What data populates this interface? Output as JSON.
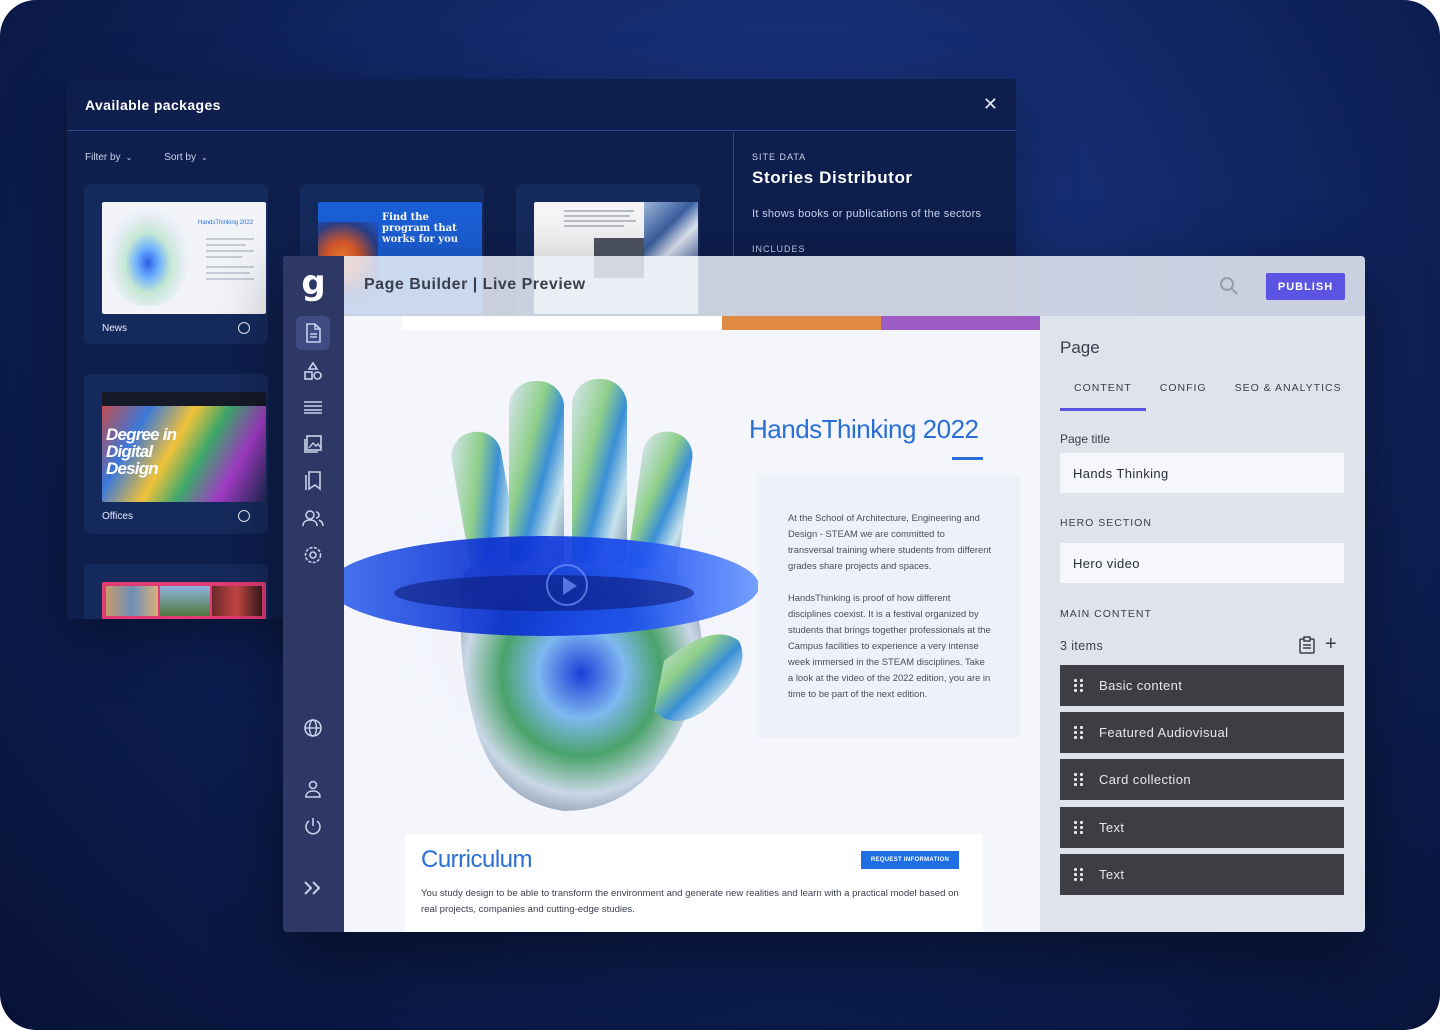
{
  "packages": {
    "title": "Available packages",
    "filter_label": "Filter by",
    "sort_label": "Sort by",
    "cards": [
      {
        "label": "News",
        "mini_title": "HandsThinking 2022"
      },
      {
        "label": "",
        "headline": "Find the program that works for you"
      },
      {
        "label": ""
      },
      {
        "label": "Offices",
        "headline": "Degree in Digital Design"
      },
      {
        "label": ""
      }
    ],
    "site_data": {
      "label": "SITE DATA",
      "title": "Stories Distributor",
      "description": "It shows books or publications of the sectors",
      "includes_label": "INCLUDES"
    }
  },
  "builder": {
    "logo": "g",
    "title": "Page Builder | Live Preview",
    "publish_label": "PUBLISH",
    "nav_icons": [
      "document-icon",
      "shapes-icon",
      "menu-lines-icon",
      "image-icon",
      "bookmark-icon",
      "users-icon",
      "settings-icon",
      "globe-icon",
      "user-icon",
      "power-icon",
      "expand-icon"
    ],
    "preview": {
      "hero_title": "HandsThinking 2022",
      "hero_paragraphs": [
        "At the School of Architecture, Engineering and Design - STEAM we are committed to transversal training where students from different grades share projects and spaces.",
        "HandsThinking is proof of how different disciplines coexist. It is a festival organized by students that brings together professionals at the Campus facilities to experience a very intense week immersed in the STEAM disciplines. Take a look at the video of the 2022 edition, you are in time to be part of the next edition."
      ],
      "curriculum_title": "Curriculum",
      "curriculum_button": "REQUEST INFORMATION",
      "curriculum_text": "You study design to be able to transform the environment and generate new realities and learn with a practical model based on real projects, companies and cutting-edge studies."
    },
    "panel": {
      "title": "Page",
      "tabs": [
        "CONTENT",
        "CONFIG",
        "SEO & ANALYTICS"
      ],
      "page_title_label": "Page title",
      "page_title_value": "Hands Thinking",
      "hero_section_label": "HERO SECTION",
      "hero_value": "Hero video",
      "main_content_label": "MAIN CONTENT",
      "items_count": "3 items",
      "items": [
        "Basic content",
        "Featured Audiovisual",
        "Card collection",
        "Text",
        "Text"
      ]
    }
  },
  "colors": {
    "accent": "#5b53e2",
    "brand_blue": "#2a6fd6",
    "nav_bg": "#2d3865",
    "strip_orange": "#e08a45",
    "strip_purple": "#9c5cc4"
  }
}
